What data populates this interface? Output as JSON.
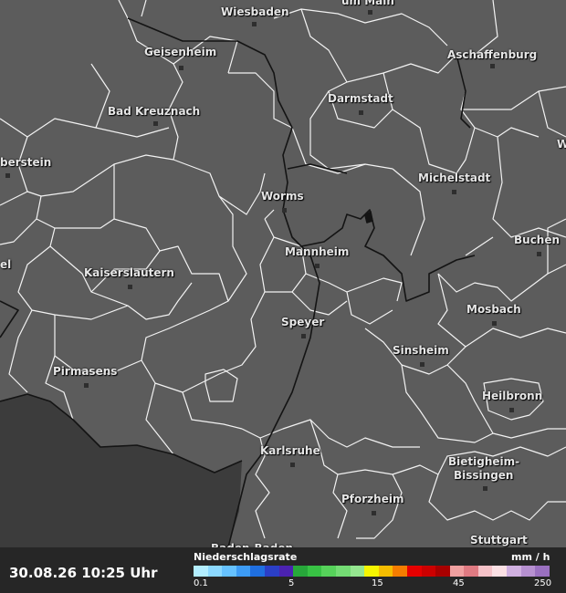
{
  "cities": [
    {
      "name": "Wiesbaden",
      "id": "wiesbaden"
    },
    {
      "name": "um Main",
      "id": "frankfurt"
    },
    {
      "name": "Geisenheim",
      "id": "geisenheim"
    },
    {
      "name": "Aschaffenburg",
      "id": "aschaffenburg"
    },
    {
      "name": "Darmstadt",
      "id": "darmstadt"
    },
    {
      "name": "Bad Kreuznach",
      "id": "bad-kreuznach"
    },
    {
      "name": "W",
      "id": "w-edge"
    },
    {
      "name": "berstein",
      "id": "idar-oberstein"
    },
    {
      "name": "Michelstadt",
      "id": "michelstadt"
    },
    {
      "name": "Worms",
      "id": "worms"
    },
    {
      "name": "Buchen",
      "id": "buchen"
    },
    {
      "name": "Mannheim",
      "id": "mannheim"
    },
    {
      "name": "el",
      "id": "kusel"
    },
    {
      "name": "Kaiserslautern",
      "id": "kaiserslautern"
    },
    {
      "name": "Mosbach",
      "id": "mosbach"
    },
    {
      "name": "Speyer",
      "id": "speyer"
    },
    {
      "name": "Sinsheim",
      "id": "sinsheim"
    },
    {
      "name": "Pirmasens",
      "id": "pirmasens"
    },
    {
      "name": "Heilbronn",
      "id": "heilbronn"
    },
    {
      "name": "Karlsruhe",
      "id": "karlsruhe"
    },
    {
      "name": "Bietigheim-",
      "id": "bietigheim-1"
    },
    {
      "name": "Bissingen",
      "id": "bietigheim-2"
    },
    {
      "name": "Pforzheim",
      "id": "pforzheim"
    },
    {
      "name": "Stuttgart",
      "id": "stuttgart"
    },
    {
      "name": "Baden-Baden",
      "id": "baden-baden"
    }
  ],
  "timestamp": "30.08.26 10:25 Uhr",
  "legend": {
    "title": "Niederschlagsrate",
    "unit": "mm / h",
    "ticks": [
      "0.1",
      "5",
      "15",
      "45",
      "250"
    ],
    "colors": [
      "#b3eeff",
      "#8cd9ff",
      "#66c2ff",
      "#3d9cf5",
      "#1f6fe0",
      "#2b3fc7",
      "#4b22b0",
      "#27a73a",
      "#38c244",
      "#56d25a",
      "#74dc74",
      "#95e690",
      "#f5f500",
      "#f5bd00",
      "#f57d00",
      "#e60000",
      "#cc0000",
      "#a80000",
      "#f0a0a0",
      "#e07a82",
      "#f5c2c8",
      "#fbe0e4",
      "#d0b0e0",
      "#b690d0",
      "#9a70c0"
    ]
  }
}
